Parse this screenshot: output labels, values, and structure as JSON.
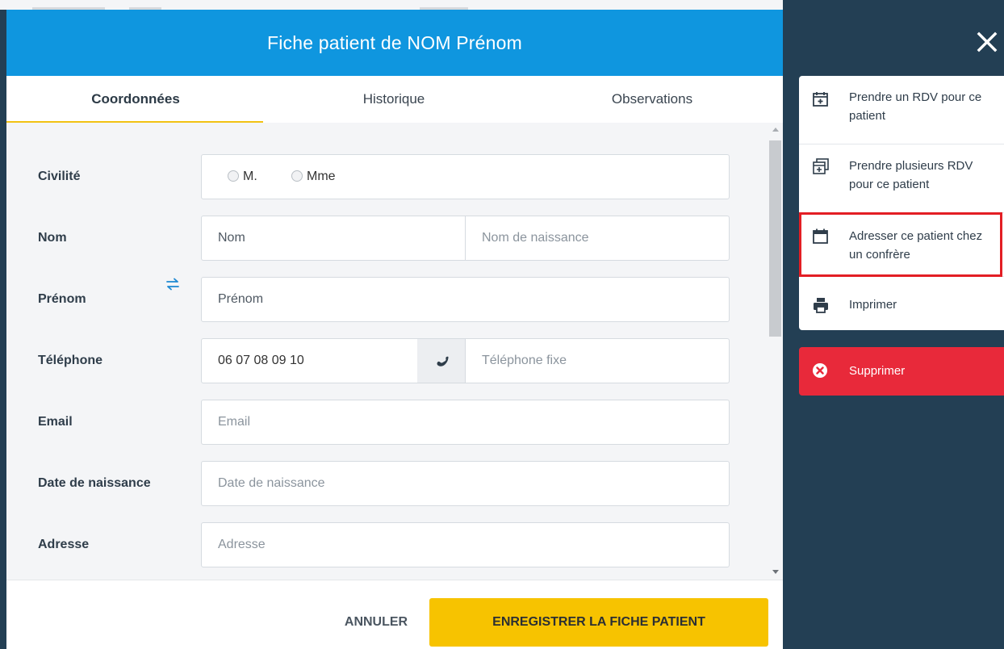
{
  "modal": {
    "title": "Fiche patient de NOM Prénom",
    "tabs": [
      {
        "label": "Coordonnées",
        "active": true
      },
      {
        "label": "Historique",
        "active": false
      },
      {
        "label": "Observations",
        "active": false
      }
    ]
  },
  "form": {
    "civilite": {
      "label": "Civilité",
      "options": [
        "M.",
        "Mme"
      ]
    },
    "nom": {
      "label": "Nom",
      "placeholder": "Nom",
      "birth_placeholder": "Nom de naissance"
    },
    "prenom": {
      "label": "Prénom",
      "placeholder": "Prénom"
    },
    "telephone": {
      "label": "Téléphone",
      "value": "06 07 08 09 10",
      "fixe_placeholder": "Téléphone fixe"
    },
    "email": {
      "label": "Email",
      "placeholder": "Email"
    },
    "date_naissance": {
      "label": "Date de naissance",
      "placeholder": "Date de naissance"
    },
    "adresse": {
      "label": "Adresse",
      "placeholder": "Adresse"
    }
  },
  "footer": {
    "cancel_label": "ANNULER",
    "save_label": "ENREGISTRER LA FICHE PATIENT"
  },
  "sidebar": {
    "items": [
      {
        "label": "Prendre un RDV pour ce patient",
        "icon": "calendar-plus-icon"
      },
      {
        "label": "Prendre plusieurs RDV pour ce patient",
        "icon": "calendar-multiple-icon"
      },
      {
        "label": "Adresser ce patient chez un confrère",
        "icon": "calendar-icon",
        "highlighted": true
      },
      {
        "label": "Imprimer",
        "icon": "printer-icon"
      }
    ],
    "delete_label": "Supprimer"
  },
  "colors": {
    "header": "#0f96df",
    "accent": "#f7c300",
    "danger": "#e8293a",
    "overlay": "#233f54",
    "highlight": "#e31e24"
  }
}
